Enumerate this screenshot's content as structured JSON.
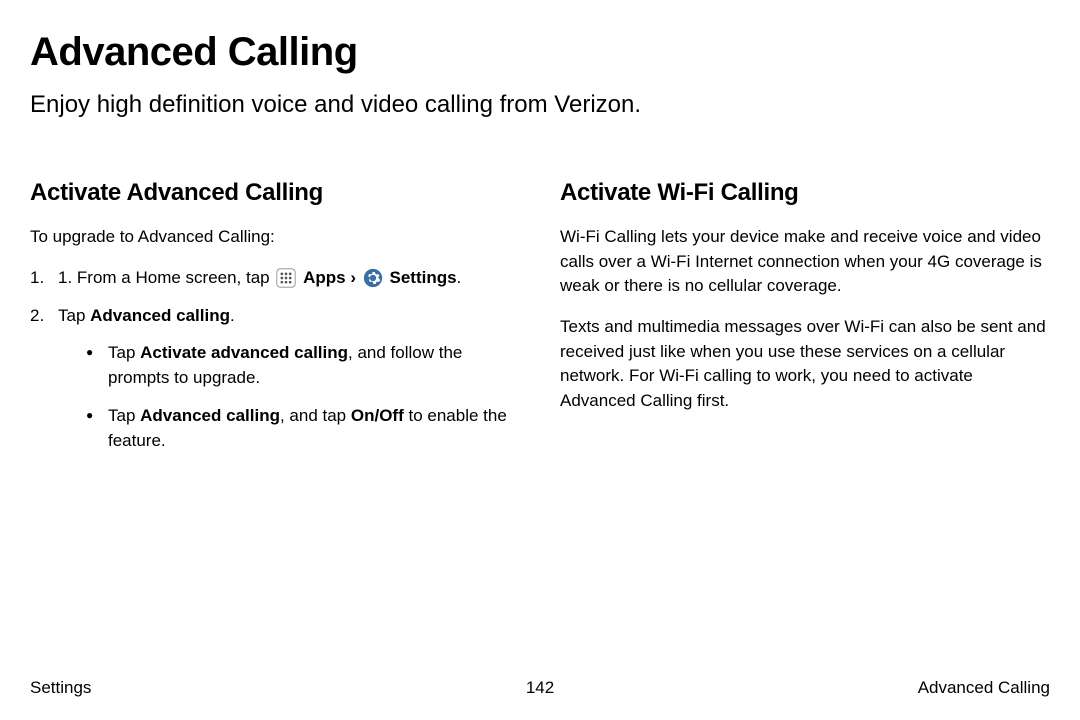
{
  "header": {
    "title": "Advanced Calling",
    "subtitle": "Enjoy high definition voice and video calling from Verizon."
  },
  "left": {
    "heading": "Activate Advanced Calling",
    "intro": "To upgrade to Advanced Calling:",
    "step1_prefix": "1. From a Home screen, tap ",
    "apps_label": "Apps",
    "arrow": "›",
    "settings_label": "Settings",
    "step1_suffix": ".",
    "step2_prefix": "Tap ",
    "step2_bold": "Advanced calling",
    "step2_suffix": ".",
    "bullet1_a": "Tap ",
    "bullet1_b": "Activate advanced calling",
    "bullet1_c": ", and follow the prompts to upgrade.",
    "bullet2_a": "Tap ",
    "bullet2_b": "Advanced calling",
    "bullet2_c": ", and tap ",
    "bullet2_d": "On/Off",
    "bullet2_e": " to enable the feature."
  },
  "right": {
    "heading": "Activate Wi-Fi Calling",
    "p1": "Wi-Fi Calling lets your device make and receive voice and video calls over a Wi-Fi Internet connection when your 4G coverage is weak or there is no cellular coverage.",
    "p2": "Texts and multimedia messages over Wi-Fi can also be sent and received just like when you use these services on a cellular network. For Wi-Fi calling to work, you need to activate Advanced Calling first."
  },
  "footer": {
    "left": "Settings",
    "center": "142",
    "right": "Advanced Calling"
  }
}
